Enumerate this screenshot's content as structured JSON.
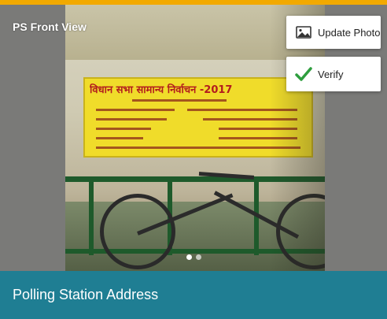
{
  "header": {
    "label": "PS Front View"
  },
  "actions": {
    "update_photo_label": "Update Photo",
    "update_photo_icon": "photo-icon",
    "verify_label": "Verify",
    "verify_icon": "check-icon"
  },
  "photo": {
    "sign_title": "विधान सभा सामान्य निर्वाचन -2017"
  },
  "carousel": {
    "page_count": 2,
    "active_index": 0
  },
  "footer": {
    "title": "Polling Station Address"
  },
  "colors": {
    "accent_top": "#f2a900",
    "footer_bg": "#1f7e93",
    "verify_check": "#2e9e3e"
  }
}
